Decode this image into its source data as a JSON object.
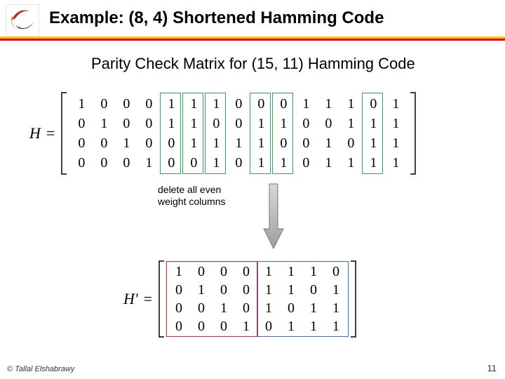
{
  "header": {
    "title": "Example: (8, 4) Shortened Hamming Code"
  },
  "subtitle": "Parity Check Matrix for (15, 11) Hamming Code",
  "matrix1": {
    "label": "H",
    "rows": [
      [
        "1",
        "0",
        "0",
        "0",
        "1",
        "1",
        "1",
        "0",
        "0",
        "0",
        "1",
        "1",
        "1",
        "0",
        "1"
      ],
      [
        "0",
        "1",
        "0",
        "0",
        "1",
        "1",
        "0",
        "0",
        "1",
        "1",
        "0",
        "0",
        "1",
        "1",
        "1"
      ],
      [
        "0",
        "0",
        "1",
        "0",
        "0",
        "1",
        "1",
        "1",
        "1",
        "0",
        "0",
        "1",
        "0",
        "1",
        "1"
      ],
      [
        "0",
        "0",
        "0",
        "1",
        "0",
        "0",
        "1",
        "0",
        "1",
        "1",
        "0",
        "1",
        "1",
        "1",
        "1"
      ]
    ]
  },
  "matrix2": {
    "label": "H'",
    "rows": [
      [
        "1",
        "0",
        "0",
        "0",
        "1",
        "1",
        "1",
        "0"
      ],
      [
        "0",
        "1",
        "0",
        "0",
        "1",
        "1",
        "0",
        "1"
      ],
      [
        "0",
        "0",
        "1",
        "0",
        "1",
        "0",
        "1",
        "1"
      ],
      [
        "0",
        "0",
        "0",
        "1",
        "0",
        "1",
        "1",
        "1"
      ]
    ]
  },
  "arrow_label": {
    "line1": "delete all even",
    "line2": "weight columns"
  },
  "footer": {
    "copyright": "© Tallal Elshabrawy",
    "page": "11"
  }
}
